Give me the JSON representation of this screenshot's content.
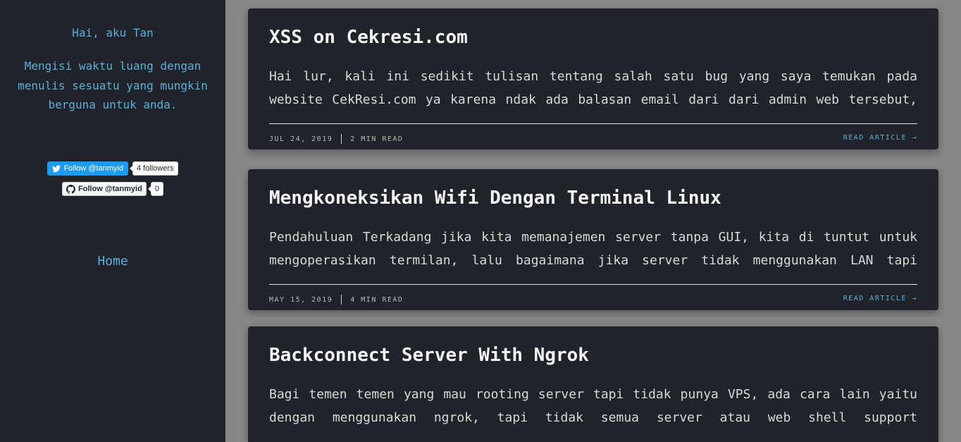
{
  "sidebar": {
    "greeting": "Hai, aku Tan",
    "bio": "Mengisi waktu luang dengan menulis sesuatu yang mungkin berguna untuk anda.",
    "twitter": {
      "button_label": "Follow @tanmyid",
      "count": "4 followers",
      "icon": "twitter-bird-icon"
    },
    "github": {
      "button_label": "Follow @tanmyid",
      "count": "0",
      "icon": "github-octocat-icon"
    },
    "nav": {
      "home": "Home"
    }
  },
  "posts": [
    {
      "title": "XSS on Cekresi.com",
      "excerpt": "Hai lur, kali ini sedikit tulisan tentang salah satu bug yang saya temukan pada website CekResi.com ya karena ndak ada balasan email dari dari admin web tersebut,",
      "date": "JUL 24, 2019",
      "read_time": "2 MIN READ",
      "read_more": "READ ARTICLE →"
    },
    {
      "title": "Mengkoneksikan Wifi Dengan Terminal Linux",
      "excerpt": "Pendahuluan Terkadang jika kita memanajemen server tanpa GUI, kita di tuntut untuk mengoperasikan termilan, lalu bagaimana jika server tidak menggunakan LAN tapi",
      "date": "MAY 15, 2019",
      "read_time": "4 MIN READ",
      "read_more": "READ ARTICLE →"
    },
    {
      "title": "Backconnect Server With Ngrok",
      "excerpt": "Bagi temen temen yang mau rooting server tapi tidak punya VPS, ada cara lain yaitu dengan menggunakan ngrok, tapi tidak semua server atau web shell support",
      "date": "",
      "read_time": "",
      "read_more": ""
    }
  ],
  "colors": {
    "page_bg": "#888787",
    "panel_bg": "#202329",
    "accent": "#5bb0da",
    "twitter_blue": "#1d9bf0"
  }
}
